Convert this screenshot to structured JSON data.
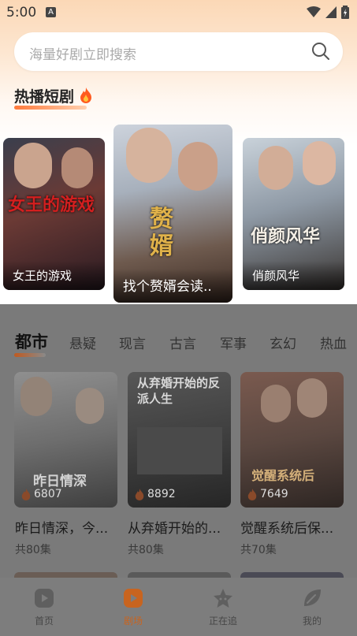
{
  "status_bar": {
    "time": "5:00",
    "a_badge": "A"
  },
  "search": {
    "placeholder": "海量好剧立即搜索"
  },
  "hot_section": {
    "title": "热播短剧",
    "items": [
      {
        "label": "女王的游戏",
        "poster_text": "女王的游戏"
      },
      {
        "label": "找个赘婿会读..",
        "poster_text": "赘婿"
      },
      {
        "label": "俏颜风华",
        "poster_text": "俏颜风华"
      }
    ]
  },
  "categories": {
    "tabs": [
      "都市",
      "悬疑",
      "现言",
      "古言",
      "军事",
      "玄幻",
      "热血"
    ],
    "active": "都市"
  },
  "dramas": [
    {
      "title": "昨日情深，今...",
      "episodes": "共80集",
      "views": "6807",
      "poster_text": "昨日情深"
    },
    {
      "title": "从弃婚开始的...",
      "episodes": "共80集",
      "views": "8892",
      "poster_text": "从弃婚开始的反派人生"
    },
    {
      "title": "觉醒系统后保...",
      "episodes": "共70集",
      "views": "7649",
      "poster_text": "觉醒系统后"
    }
  ],
  "bottom_nav": [
    {
      "label": "首页",
      "icon": "play-icon"
    },
    {
      "label": "剧场",
      "icon": "theater-icon"
    },
    {
      "label": "正在追",
      "icon": "star-icon"
    },
    {
      "label": "我的",
      "icon": "leaf-icon"
    }
  ],
  "colors": {
    "accent": "#ff7a3c",
    "active_nav": "#c8641f",
    "dim_background": "#7a7a7a"
  }
}
